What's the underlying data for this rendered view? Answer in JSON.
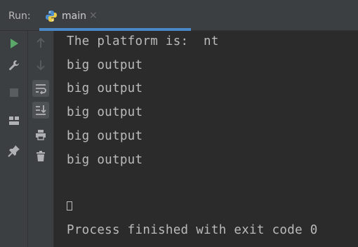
{
  "run_panel": {
    "label": "Run:",
    "tab": {
      "name": "main",
      "close_glyph": "×",
      "icon": "python-icon"
    }
  },
  "toolbar_left": [
    {
      "icon": "play-icon",
      "color": "#59a869"
    },
    {
      "icon": "wrench-icon",
      "color": "#afb1b3"
    },
    {
      "icon": "stop-icon",
      "color": "#5a5d5f"
    },
    {
      "icon": "layout-icon",
      "color": "#afb1b3"
    },
    {
      "icon": "pin-icon",
      "color": "#afb1b3"
    }
  ],
  "toolbar_mid": [
    {
      "icon": "arrow-up-icon",
      "color": "#5a5d5f"
    },
    {
      "icon": "arrow-down-icon",
      "color": "#5a5d5f"
    },
    {
      "icon": "soft-wrap-icon",
      "color": "#afb1b3",
      "active": true
    },
    {
      "icon": "scroll-to-end-icon",
      "color": "#afb1b3",
      "active": true
    },
    {
      "icon": "print-icon",
      "color": "#afb1b3"
    },
    {
      "icon": "trash-icon",
      "color": "#afb1b3"
    }
  ],
  "console": {
    "lines": [
      "The platform is:  nt",
      "big output",
      "big output",
      "big output",
      "big output",
      "big output"
    ],
    "exit_message": "Process finished with exit code 0"
  },
  "colors": {
    "accent": "#4a88c7",
    "text": "#bbbbbb",
    "background": "#2b2b2b",
    "panel": "#3c3f41"
  }
}
